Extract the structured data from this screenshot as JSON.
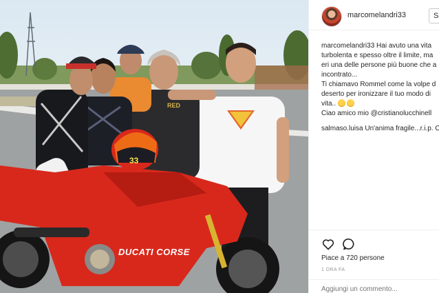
{
  "post": {
    "username": "marcomelandri33",
    "follow_label": "Se",
    "caption_lines": [
      "marcomelandri33 Hai avuto una vita",
      "turbolenta e spesso oltre il limite, ma",
      "eri una delle persone più buone che a",
      "incontrato...",
      "Ti chiamavo Rommel come la volpe d",
      "deserto per ironizzare il tuo modo di",
      "vita..",
      "Ciao amico mio @cristianolucchinell",
      "salmaso.luisa Un'anima fragile...r.i.p. C"
    ],
    "likes_text": "Piace a 720 persone",
    "time_ago": "1 ORA FA",
    "comment_placeholder": "Aggiungi un commento..."
  },
  "photo": {
    "bike_brand": "DUCATI CORSE",
    "helmet_number": "33",
    "shirt_text": "RED"
  },
  "icons": {
    "like": "heart-icon",
    "comment": "comment-bubble-icon",
    "emoji": "sad-face-emoji-icon"
  },
  "colors": {
    "bike_red": "#d8281c",
    "sky": "#dbe8f2",
    "text": "#262626",
    "muted": "#999999",
    "divider": "#efefef"
  }
}
